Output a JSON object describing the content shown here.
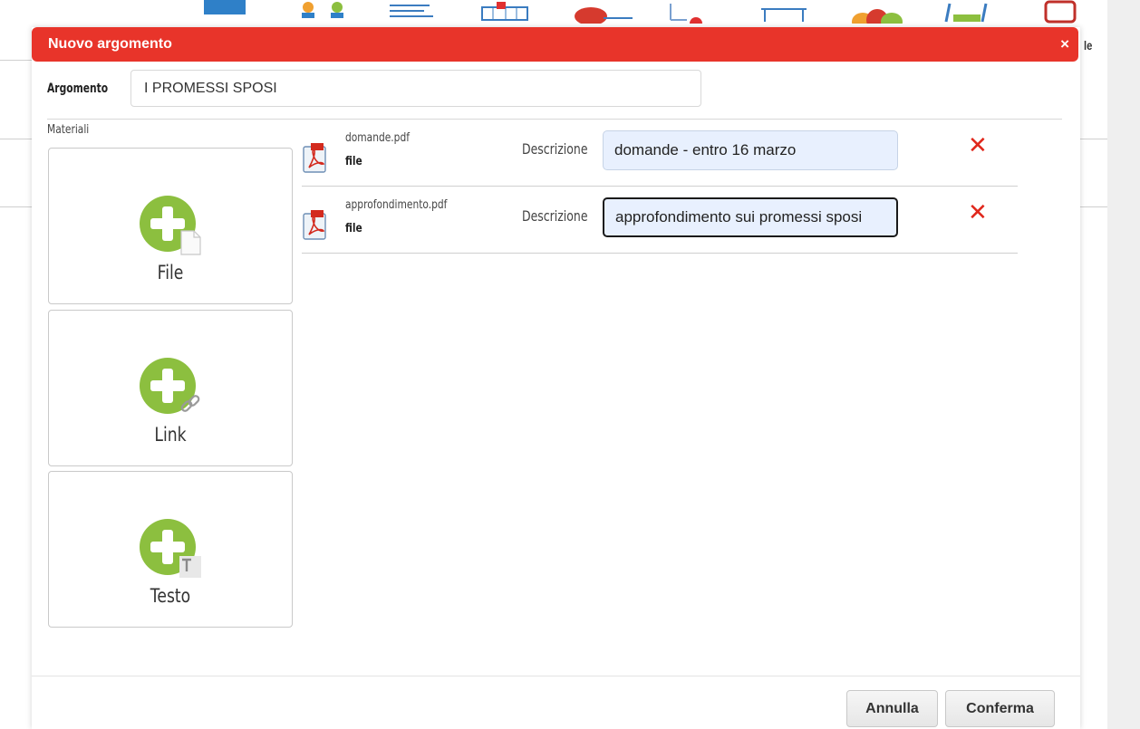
{
  "background": {
    "toolbar_icons": [
      "calendar-icon",
      "users-icon",
      "list-icon",
      "grid-icon",
      "teacher-icon",
      "document-alert-icon",
      "desk-icon",
      "group-icon",
      "chart-icon",
      "book-icon"
    ],
    "partial_label": "le"
  },
  "dialog": {
    "title": "Nuovo argomento",
    "close": "×",
    "argument_label": "Argomento",
    "argument_value": "I PROMESSI SPOSI",
    "materials_label": "Materiali",
    "tiles": [
      {
        "label": "File",
        "icon": "add-file-icon"
      },
      {
        "label": "Link",
        "icon": "add-link-icon"
      },
      {
        "label": "Testo",
        "icon": "add-text-icon"
      }
    ],
    "files": [
      {
        "name": "domande.pdf",
        "type": "file",
        "description_label": "Descrizione",
        "description": "domande - entro 16 marzo",
        "delete": "✕"
      },
      {
        "name": "approfondimento.pdf",
        "type": "file",
        "description_label": "Descrizione",
        "description": "approfondimento sui promessi sposi",
        "delete": "✕"
      }
    ],
    "buttons": {
      "cancel": "Annulla",
      "confirm": "Conferma"
    }
  },
  "colors": {
    "title_bar": "#e8342a",
    "plus_green": "#8cbf3f",
    "delete_red": "#e0271b",
    "autofill_blue": "#e8f0fe"
  }
}
